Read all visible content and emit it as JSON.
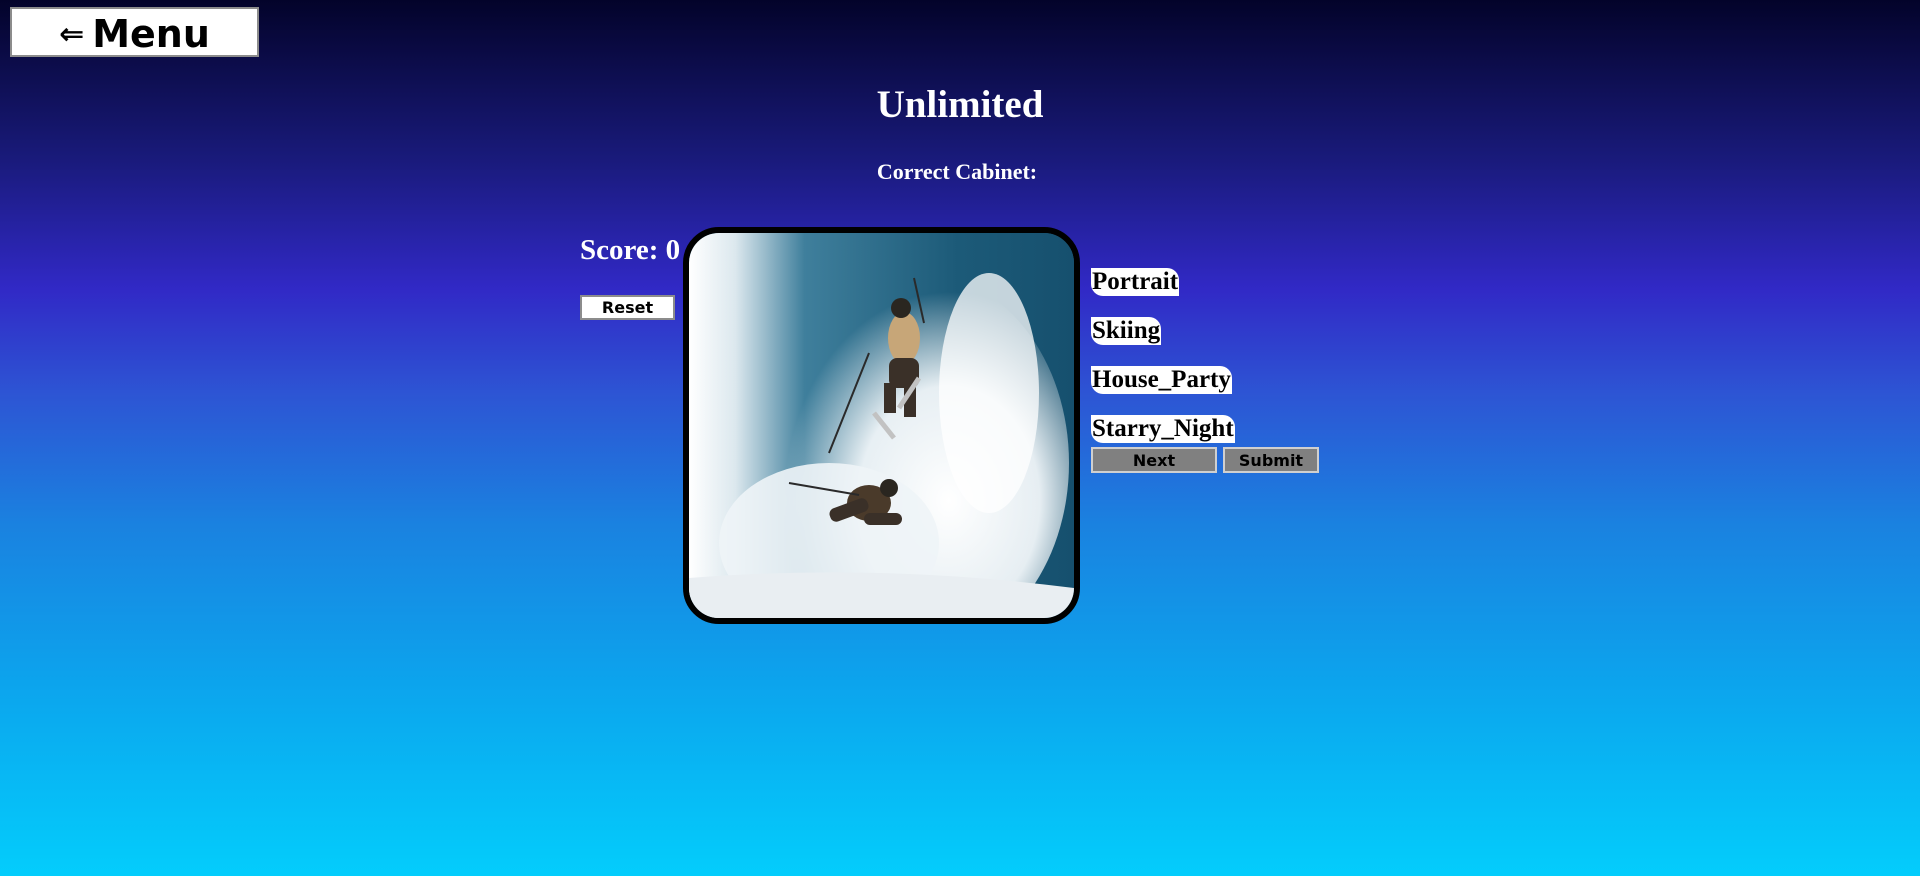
{
  "menu": {
    "arrow": "⇐",
    "label": "Menu"
  },
  "title": "Unlimited",
  "correct_cabinet": {
    "label": "Correct Cabinet:",
    "value": ""
  },
  "score": {
    "text": "Score: 0"
  },
  "buttons": {
    "reset": "Reset",
    "next": "Next",
    "submit": "Submit"
  },
  "image": {
    "subject": "two-skiers-powder-snow"
  },
  "cabinets": [
    {
      "label": "Portrait"
    },
    {
      "label": "Skiing"
    },
    {
      "label": "House_Party"
    },
    {
      "label": "Starry_Night"
    }
  ],
  "colors": {
    "gradient_top": "#03032a",
    "gradient_mid": "#3129c6",
    "gradient_bottom": "#03cdfc",
    "button_gray": "#808080"
  }
}
